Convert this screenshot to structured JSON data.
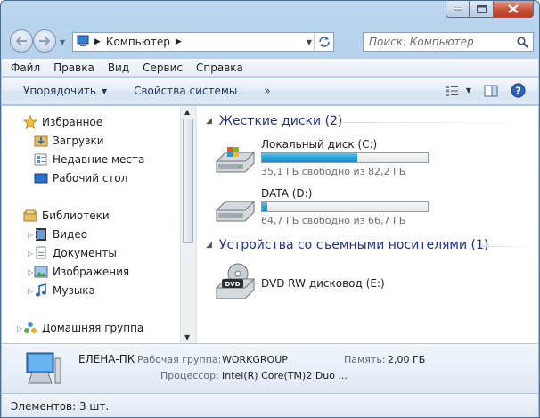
{
  "window": {
    "colors": {
      "accent": "#1e3287",
      "bar_fill": "#26a0da",
      "close": "#c7523d"
    }
  },
  "address": {
    "path": "Компьютер",
    "icon": "computer-icon"
  },
  "search": {
    "placeholder": "Поиск: Компьютер"
  },
  "menu": {
    "items": [
      "Файл",
      "Правка",
      "Вид",
      "Сервис",
      "Справка"
    ]
  },
  "commands": {
    "organize": "Упорядочить",
    "system_properties": "Свойства системы",
    "more": "»"
  },
  "nav": {
    "favorites": "Избранное",
    "downloads": "Загрузки",
    "recent": "Недавние места",
    "desktop": "Рабочий стол",
    "libraries": "Библиотеки",
    "video": "Видео",
    "documents": "Документы",
    "images": "Изображения",
    "music": "Музыка",
    "homegroup": "Домашняя группа"
  },
  "groups": {
    "hard_disks": "Жесткие диски (2)",
    "removable": "Устройства со съемными носителями (1)"
  },
  "drives": [
    {
      "name": "Локальный диск (C:)",
      "info": "35,1 ГБ свободно из 82,2 ГБ",
      "used_fraction": 0.573
    },
    {
      "name": "DATA (D:)",
      "info": "64,7 ГБ свободно из 66,7 ГБ",
      "used_fraction": 0.03
    }
  ],
  "dvd": {
    "name": "DVD RW дисковод (E:)",
    "label": "DVD"
  },
  "details": {
    "computer_name": "ЕЛЕНА-ПК",
    "workgroup_label": "Рабочая группа:",
    "workgroup_value": "WORKGROUP",
    "memory_label": "Память:",
    "memory_value": "2,00 ГБ",
    "cpu_label": "Процессор:",
    "cpu_value": "Intel(R) Core(TM)2 Duo ..."
  },
  "status": {
    "text": "Элементов: 3 шт."
  }
}
